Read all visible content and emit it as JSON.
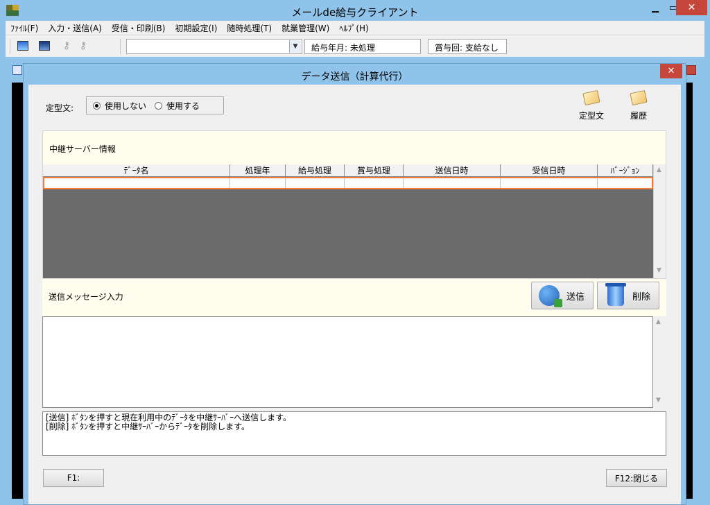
{
  "app": {
    "title": "メールde給与クライアント",
    "menu": [
      "ﾌｧｲﾙ(F)",
      "入力・送信(A)",
      "受信・印刷(B)",
      "初期設定(I)",
      "随時処理(T)",
      "就業管理(W)",
      "ﾍﾙﾌﾟ(H)"
    ],
    "toolbar": {
      "combo_value": "",
      "salary_field": "給与年月: 未処理",
      "bonus_field": "賞与回: 支給なし"
    }
  },
  "dialog": {
    "title": "データ送信（計算代行）",
    "teikei_label": "定型文:",
    "radio_not_use": "使用しない",
    "radio_use": "使用する",
    "radio_selected": "使用しない",
    "tool_teikei": "定型文",
    "tool_history": "履歴",
    "server_section_label": "中継サーバー情報",
    "grid": {
      "columns": [
        "ﾃﾞｰﾀ名",
        "処理年",
        "給与処理",
        "賞与処理",
        "送信日時",
        "受信日時",
        "ﾊﾞｰｼﾞｮﾝ"
      ],
      "rows": [
        [
          "",
          "",
          "",
          "",
          "",
          "",
          ""
        ]
      ]
    },
    "msg_section_label": "送信メッセージ入力",
    "send_button": "送信",
    "delete_button": "削除",
    "message_text": "",
    "help_line1": "[送信] ﾎﾞﾀﾝを押すと現在利用中のﾃﾞｰﾀを中継ｻｰﾊﾞｰへ送信します。",
    "help_line2": "[削除] ﾎﾞﾀﾝを押すと中継ｻｰﾊﾞｰからﾃﾞｰﾀを削除します。",
    "f1_button": "F1:",
    "f12_button": "F12:閉じる"
  },
  "colors": {
    "frame": "#8fc3ea",
    "close": "#c7463b",
    "section_bg": "#fffdee",
    "grid_empty": "#6b6b6b",
    "selected_row_border": "#f07a3a"
  },
  "icons": [
    "app-icon",
    "monitor-icon",
    "key-icon",
    "book-icon",
    "globe-upload-icon",
    "trash-icon"
  ]
}
